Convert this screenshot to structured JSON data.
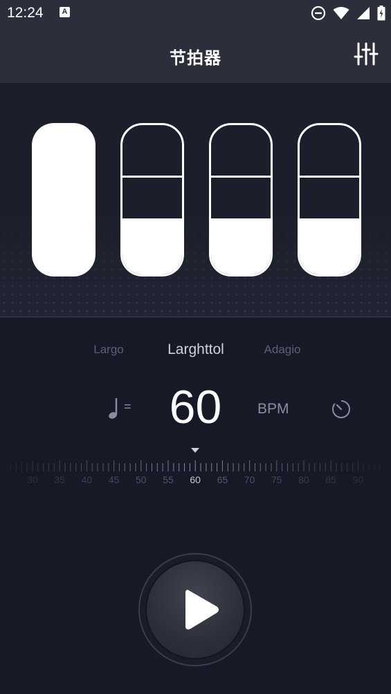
{
  "status_bar": {
    "time": "12:24",
    "notification_letter": "A"
  },
  "app_bar": {
    "title": "节拍器"
  },
  "beats": [
    {
      "type": "accent"
    },
    {
      "type": "normal"
    },
    {
      "type": "normal"
    },
    {
      "type": "normal"
    }
  ],
  "tempo": {
    "names": [
      "Largo",
      "Larghttol",
      "Adagio"
    ],
    "selected_index": 1
  },
  "bpm": {
    "note_symbol": "=",
    "value": "60",
    "unit": "BPM"
  },
  "ruler": {
    "labels": [
      "30",
      "35",
      "40",
      "45",
      "50",
      "55",
      "60",
      "65",
      "70",
      "75",
      "80",
      "85",
      "90"
    ],
    "selected": "60"
  }
}
